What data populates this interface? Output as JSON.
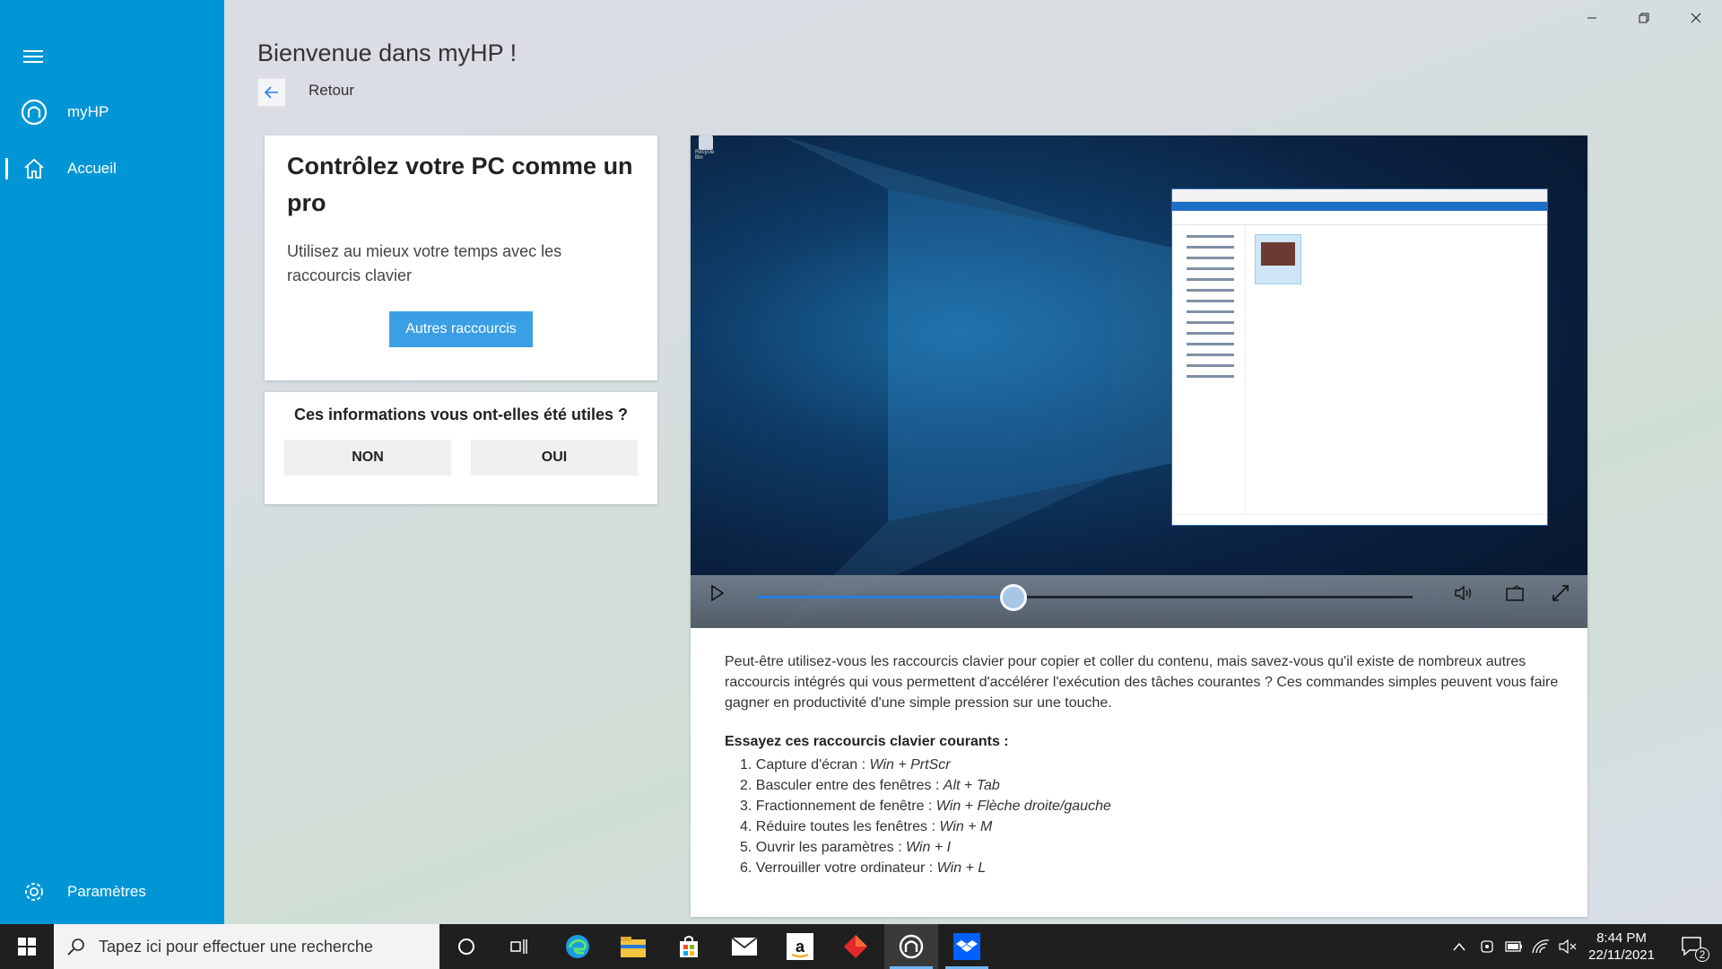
{
  "app": {
    "name": "myHP"
  },
  "sidebar": {
    "items": [
      {
        "label": "myHP",
        "icon": "hp-logo-icon"
      },
      {
        "label": "Accueil",
        "icon": "home-icon"
      }
    ],
    "settings_label": "Paramètres",
    "bg_color": "#0096d6"
  },
  "header": {
    "title": "Bienvenue dans myHP !",
    "back_label": "Retour"
  },
  "card_main": {
    "title": "Contrôlez votre PC comme un pro",
    "subtitle": "Utilisez au mieux votre temps avec les raccourcis clavier",
    "button": "Autres raccourcis"
  },
  "feedback": {
    "question": "Ces informations vous ont-elles été utiles ?",
    "no": "NON",
    "yes": "OUI"
  },
  "video": {
    "progress": 0.39,
    "accent": "#2b7de2"
  },
  "article": {
    "intro": "Peut-être utilisez-vous les raccourcis clavier pour copier et coller du contenu, mais savez-vous qu'il existe de nombreux autres raccourcis intégrés qui vous permettent d'accélérer l'exécution des tâches courantes ? Ces commandes simples peuvent vous faire gagner en productivité d'une simple pression sur une touche.",
    "list_title": "Essayez ces raccourcis clavier courants :",
    "tips": [
      {
        "num": "1.",
        "label": "Capture d'écran : ",
        "keys": "Win + PrtScr"
      },
      {
        "num": "2.",
        "label": "Basculer entre des fenêtres : ",
        "keys": "Alt + Tab"
      },
      {
        "num": "3.",
        "label": "Fractionnement de fenêtre : ",
        "keys": "Win + Flèche droite/gauche"
      },
      {
        "num": "4.",
        "label": "Réduire toutes les fenêtres : ",
        "keys": "Win + M"
      },
      {
        "num": "5.",
        "label": "Ouvrir les paramètres : ",
        "keys": "Win + I"
      },
      {
        "num": "6.",
        "label": "Verrouiller votre ordinateur : ",
        "keys": "Win + L"
      }
    ]
  },
  "taskbar": {
    "search_placeholder": "Tapez ici pour effectuer une recherche",
    "time": "8:44 PM",
    "date": "22/11/2021",
    "notification_count": "2"
  }
}
